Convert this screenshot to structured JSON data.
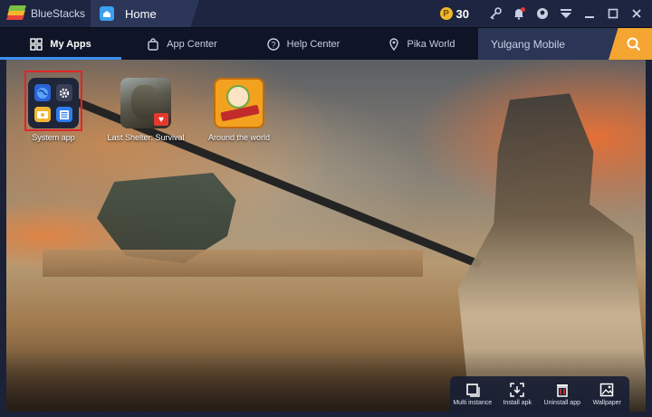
{
  "titlebar": {
    "app_name": "BlueStacks",
    "home_tab": "Home",
    "coins": "30",
    "coin_symbol": "P",
    "icons": [
      "key-icon",
      "bell-icon",
      "account-icon",
      "menu-icon",
      "minimize-icon",
      "maximize-icon",
      "close-icon"
    ]
  },
  "nav": {
    "tabs": [
      {
        "label": "My Apps",
        "icon": "grid-icon",
        "active": true
      },
      {
        "label": "App Center",
        "icon": "bag-icon",
        "active": false
      },
      {
        "label": "Help Center",
        "icon": "help-icon",
        "active": false
      },
      {
        "label": "Pika World",
        "icon": "pin-icon",
        "active": false
      }
    ],
    "search_text": "Yulgang Mobile"
  },
  "apps": [
    {
      "label": "System app"
    },
    {
      "label": "Last Shelter: Survival"
    },
    {
      "label": "Around the world"
    }
  ],
  "dock": [
    {
      "label": "Multi instance",
      "icon": "multi-instance-icon"
    },
    {
      "label": "Install apk",
      "icon": "install-apk-icon"
    },
    {
      "label": "Uninstall app",
      "icon": "uninstall-icon"
    },
    {
      "label": "Wallpaper",
      "icon": "wallpaper-icon"
    }
  ],
  "colors": {
    "accent": "#3a8ff0",
    "search_button": "#f4a532",
    "highlight": "#e0262a"
  }
}
